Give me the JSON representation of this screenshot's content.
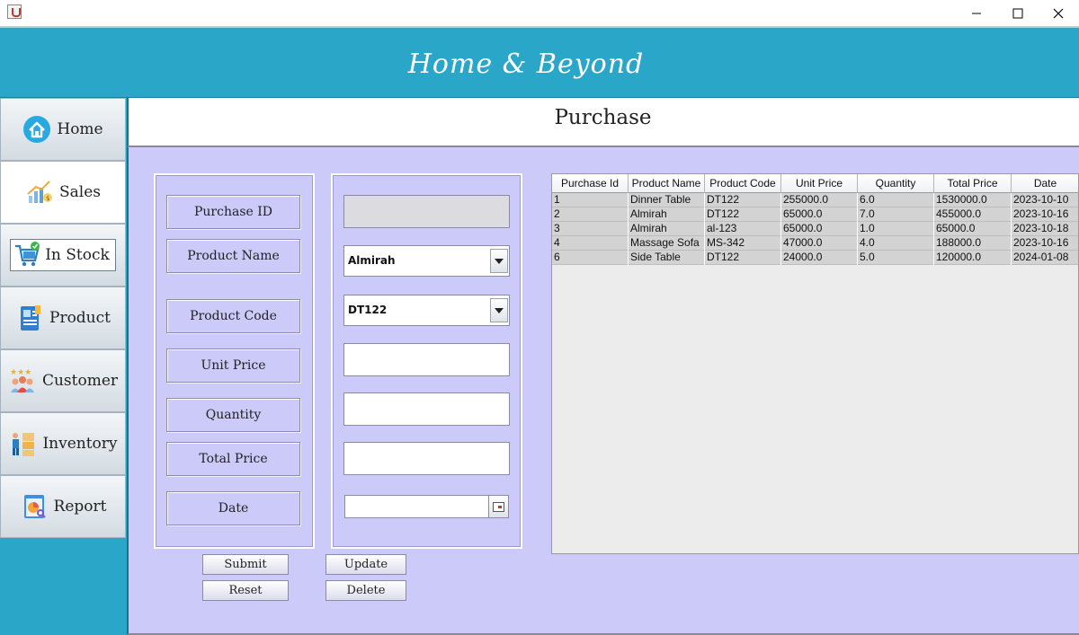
{
  "app": {
    "brand": "Home & Beyond",
    "page_title": "Purchase"
  },
  "colors": {
    "header": "#2aa6c9",
    "panel": "#cbcaf9",
    "table_row": "#d3d3d3"
  },
  "sidebar": {
    "items": [
      {
        "label": "Home",
        "icon": "home-icon"
      },
      {
        "label": "Sales",
        "icon": "sales-chart-icon"
      },
      {
        "label": "In Stock",
        "icon": "cart-check-icon"
      },
      {
        "label": "Product",
        "icon": "product-card-icon"
      },
      {
        "label": "Customer",
        "icon": "customer-group-icon"
      },
      {
        "label": "Inventory",
        "icon": "inventory-worker-icon"
      },
      {
        "label": "Report",
        "icon": "report-icon"
      }
    ]
  },
  "form": {
    "labels": {
      "purchase_id": "Purchase ID",
      "product_name": "Product Name",
      "product_code": "Product Code",
      "unit_price": "Unit Price",
      "quantity": "Quantity",
      "total_price": "Total Price",
      "date": "Date"
    },
    "values": {
      "purchase_id": "",
      "product_name": "Almirah",
      "product_code": "DT122",
      "unit_price": "",
      "quantity": "",
      "total_price": "",
      "date": ""
    },
    "buttons": {
      "submit": "Submit",
      "update": "Update",
      "reset": "Reset",
      "delete": "Delete"
    }
  },
  "table": {
    "columns": [
      "Purchase Id",
      "Product Name",
      "Product Code",
      "Unit Price",
      "Quantity",
      "Total Price",
      "Date"
    ],
    "rows": [
      [
        "1",
        "Dinner Table",
        "DT122",
        "255000.0",
        "6.0",
        "1530000.0",
        "2023-10-10"
      ],
      [
        "2",
        "Almirah",
        "DT122",
        "65000.0",
        "7.0",
        "455000.0",
        "2023-10-16"
      ],
      [
        "3",
        "Almirah",
        "al-123",
        "65000.0",
        "1.0",
        "65000.0",
        "2023-10-18"
      ],
      [
        "4",
        "Massage Sofa",
        "MS-342",
        "47000.0",
        "4.0",
        "188000.0",
        "2023-10-16"
      ],
      [
        "6",
        "Side Table",
        "DT122",
        "24000.0",
        "5.0",
        "120000.0",
        "2024-01-08"
      ]
    ]
  }
}
